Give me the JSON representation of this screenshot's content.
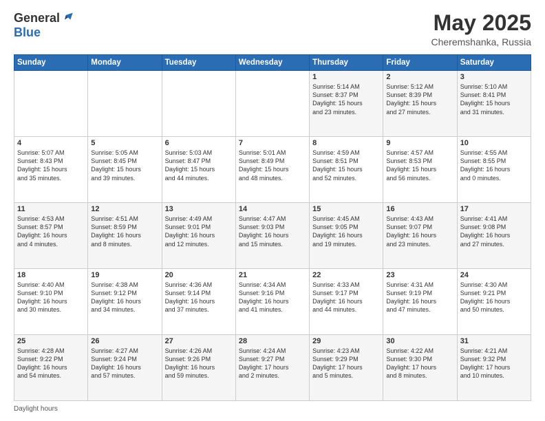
{
  "header": {
    "logo_general": "General",
    "logo_blue": "Blue",
    "month_year": "May 2025",
    "location": "Cheremshanka, Russia"
  },
  "footer": {
    "daylight_label": "Daylight hours"
  },
  "weekdays": [
    "Sunday",
    "Monday",
    "Tuesday",
    "Wednesday",
    "Thursday",
    "Friday",
    "Saturday"
  ],
  "weeks": [
    [
      {
        "day": "",
        "info": ""
      },
      {
        "day": "",
        "info": ""
      },
      {
        "day": "",
        "info": ""
      },
      {
        "day": "",
        "info": ""
      },
      {
        "day": "1",
        "info": "Sunrise: 5:14 AM\nSunset: 8:37 PM\nDaylight: 15 hours\nand 23 minutes."
      },
      {
        "day": "2",
        "info": "Sunrise: 5:12 AM\nSunset: 8:39 PM\nDaylight: 15 hours\nand 27 minutes."
      },
      {
        "day": "3",
        "info": "Sunrise: 5:10 AM\nSunset: 8:41 PM\nDaylight: 15 hours\nand 31 minutes."
      }
    ],
    [
      {
        "day": "4",
        "info": "Sunrise: 5:07 AM\nSunset: 8:43 PM\nDaylight: 15 hours\nand 35 minutes."
      },
      {
        "day": "5",
        "info": "Sunrise: 5:05 AM\nSunset: 8:45 PM\nDaylight: 15 hours\nand 39 minutes."
      },
      {
        "day": "6",
        "info": "Sunrise: 5:03 AM\nSunset: 8:47 PM\nDaylight: 15 hours\nand 44 minutes."
      },
      {
        "day": "7",
        "info": "Sunrise: 5:01 AM\nSunset: 8:49 PM\nDaylight: 15 hours\nand 48 minutes."
      },
      {
        "day": "8",
        "info": "Sunrise: 4:59 AM\nSunset: 8:51 PM\nDaylight: 15 hours\nand 52 minutes."
      },
      {
        "day": "9",
        "info": "Sunrise: 4:57 AM\nSunset: 8:53 PM\nDaylight: 15 hours\nand 56 minutes."
      },
      {
        "day": "10",
        "info": "Sunrise: 4:55 AM\nSunset: 8:55 PM\nDaylight: 16 hours\nand 0 minutes."
      }
    ],
    [
      {
        "day": "11",
        "info": "Sunrise: 4:53 AM\nSunset: 8:57 PM\nDaylight: 16 hours\nand 4 minutes."
      },
      {
        "day": "12",
        "info": "Sunrise: 4:51 AM\nSunset: 8:59 PM\nDaylight: 16 hours\nand 8 minutes."
      },
      {
        "day": "13",
        "info": "Sunrise: 4:49 AM\nSunset: 9:01 PM\nDaylight: 16 hours\nand 12 minutes."
      },
      {
        "day": "14",
        "info": "Sunrise: 4:47 AM\nSunset: 9:03 PM\nDaylight: 16 hours\nand 15 minutes."
      },
      {
        "day": "15",
        "info": "Sunrise: 4:45 AM\nSunset: 9:05 PM\nDaylight: 16 hours\nand 19 minutes."
      },
      {
        "day": "16",
        "info": "Sunrise: 4:43 AM\nSunset: 9:07 PM\nDaylight: 16 hours\nand 23 minutes."
      },
      {
        "day": "17",
        "info": "Sunrise: 4:41 AM\nSunset: 9:08 PM\nDaylight: 16 hours\nand 27 minutes."
      }
    ],
    [
      {
        "day": "18",
        "info": "Sunrise: 4:40 AM\nSunset: 9:10 PM\nDaylight: 16 hours\nand 30 minutes."
      },
      {
        "day": "19",
        "info": "Sunrise: 4:38 AM\nSunset: 9:12 PM\nDaylight: 16 hours\nand 34 minutes."
      },
      {
        "day": "20",
        "info": "Sunrise: 4:36 AM\nSunset: 9:14 PM\nDaylight: 16 hours\nand 37 minutes."
      },
      {
        "day": "21",
        "info": "Sunrise: 4:34 AM\nSunset: 9:16 PM\nDaylight: 16 hours\nand 41 minutes."
      },
      {
        "day": "22",
        "info": "Sunrise: 4:33 AM\nSunset: 9:17 PM\nDaylight: 16 hours\nand 44 minutes."
      },
      {
        "day": "23",
        "info": "Sunrise: 4:31 AM\nSunset: 9:19 PM\nDaylight: 16 hours\nand 47 minutes."
      },
      {
        "day": "24",
        "info": "Sunrise: 4:30 AM\nSunset: 9:21 PM\nDaylight: 16 hours\nand 50 minutes."
      }
    ],
    [
      {
        "day": "25",
        "info": "Sunrise: 4:28 AM\nSunset: 9:22 PM\nDaylight: 16 hours\nand 54 minutes."
      },
      {
        "day": "26",
        "info": "Sunrise: 4:27 AM\nSunset: 9:24 PM\nDaylight: 16 hours\nand 57 minutes."
      },
      {
        "day": "27",
        "info": "Sunrise: 4:26 AM\nSunset: 9:26 PM\nDaylight: 16 hours\nand 59 minutes."
      },
      {
        "day": "28",
        "info": "Sunrise: 4:24 AM\nSunset: 9:27 PM\nDaylight: 17 hours\nand 2 minutes."
      },
      {
        "day": "29",
        "info": "Sunrise: 4:23 AM\nSunset: 9:29 PM\nDaylight: 17 hours\nand 5 minutes."
      },
      {
        "day": "30",
        "info": "Sunrise: 4:22 AM\nSunset: 9:30 PM\nDaylight: 17 hours\nand 8 minutes."
      },
      {
        "day": "31",
        "info": "Sunrise: 4:21 AM\nSunset: 9:32 PM\nDaylight: 17 hours\nand 10 minutes."
      }
    ]
  ]
}
